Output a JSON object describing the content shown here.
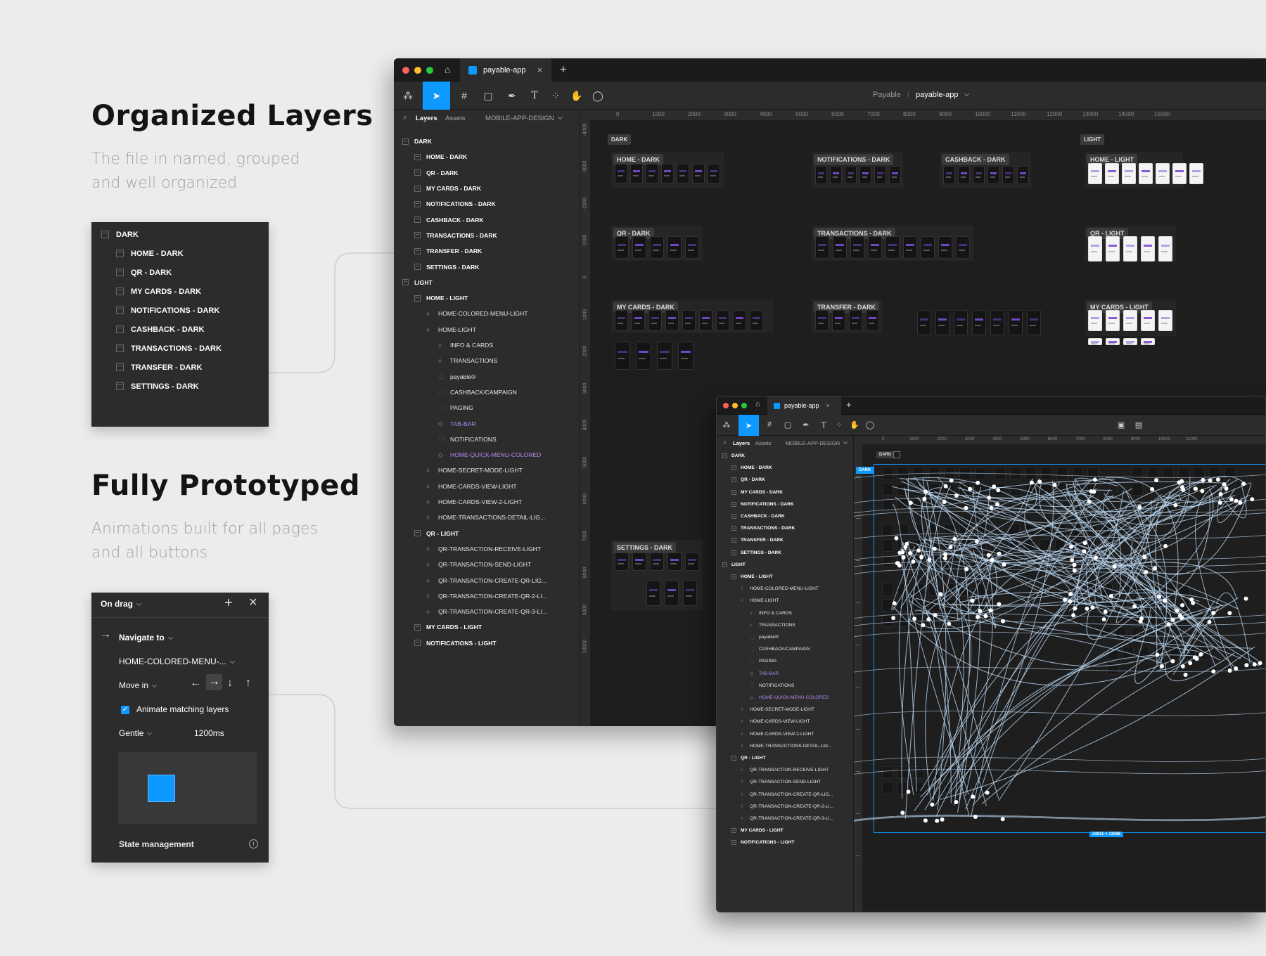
{
  "headings": {
    "organized_title": "Organized Layers",
    "organized_desc_1": "The file in named, grouped",
    "organized_desc_2": "and well organized",
    "prototyped_title": "Fully Prototyped",
    "prototyped_desc_1": "Animations built for all pages",
    "prototyped_desc_2": "and all buttons"
  },
  "layer_panel": {
    "group": "DARK",
    "items": [
      "HOME - DARK",
      "QR - DARK",
      "MY CARDS - DARK",
      "NOTIFICATIONS - DARK",
      "CASHBACK - DARK",
      "TRANSACTIONS - DARK",
      "TRANSFER - DARK",
      "SETTINGS - DARK"
    ]
  },
  "proto_panel": {
    "trigger": "On drag",
    "action": "Navigate to",
    "destination": "HOME-COLORED-MENU-...",
    "animation": "Move in",
    "animate_matching": "Animate matching layers",
    "easing": "Gentle",
    "duration": "1200ms",
    "state": "State management",
    "direction_selected": "right"
  },
  "main_window": {
    "tab": "payable-app",
    "breadcrumb_team": "Payable",
    "breadcrumb_sep": "/",
    "breadcrumb_file": "payable-app",
    "sidebar_tabs": [
      "Layers",
      "Assets"
    ],
    "page_select": "MOBILE-APP-DESIGN",
    "ruler_x": [
      "0",
      "1000",
      "2000",
      "3000",
      "4000",
      "5000",
      "6000",
      "7000",
      "8000",
      "9000",
      "10000",
      "11000",
      "12000",
      "13000",
      "14000",
      "15000"
    ],
    "ruler_y": [
      "-4000",
      "-3000",
      "-2000",
      "-1000",
      "0",
      "1000",
      "2000",
      "3000",
      "4000",
      "5000",
      "6000",
      "7000",
      "8000",
      "9000",
      "10000"
    ],
    "layers": [
      {
        "t": "DARK",
        "lvl": 0,
        "k": "frame",
        "b": true
      },
      {
        "t": "HOME - DARK",
        "lvl": 1,
        "k": "frame",
        "b": true
      },
      {
        "t": "QR - DARK",
        "lvl": 1,
        "k": "frame",
        "b": true
      },
      {
        "t": "MY CARDS - DARK",
        "lvl": 1,
        "k": "frame",
        "b": true
      },
      {
        "t": "NOTIFICATIONS - DARK",
        "lvl": 1,
        "k": "frame",
        "b": true
      },
      {
        "t": "CASHBACK - DARK",
        "lvl": 1,
        "k": "frame",
        "b": true
      },
      {
        "t": "TRANSACTIONS - DARK",
        "lvl": 1,
        "k": "frame",
        "b": true
      },
      {
        "t": "TRANSFER - DARK",
        "lvl": 1,
        "k": "frame",
        "b": true
      },
      {
        "t": "SETTINGS - DARK",
        "lvl": 1,
        "k": "frame",
        "b": true
      },
      {
        "t": "LIGHT",
        "lvl": 0,
        "k": "frame",
        "b": true
      },
      {
        "t": "HOME - LIGHT",
        "lvl": 1,
        "k": "frame",
        "b": true
      },
      {
        "t": "HOME-COLORED-MENU-LIGHT",
        "lvl": 2,
        "k": "grid"
      },
      {
        "t": "HOME-LIGHT",
        "lvl": 2,
        "k": "grid"
      },
      {
        "t": "INFO & CARDS",
        "lvl": 3,
        "k": "grid"
      },
      {
        "t": "TRANSACTIONS",
        "lvl": 3,
        "k": "grid"
      },
      {
        "t": "payable®",
        "lvl": 3,
        "k": "dash"
      },
      {
        "t": "CASHBACK/CAMPAIGN",
        "lvl": 3,
        "k": "dash"
      },
      {
        "t": "PAGING",
        "lvl": 3,
        "k": "dash"
      },
      {
        "t": "TAB-BAR",
        "lvl": 3,
        "k": "comp",
        "p": true
      },
      {
        "t": "NOTIFICATIONS",
        "lvl": 3,
        "k": "dash"
      },
      {
        "t": "HOME-QUICK-MENU-COLORED",
        "lvl": 3,
        "k": "comp",
        "p": true
      },
      {
        "t": "HOME-SECRET-MODE-LIGHT",
        "lvl": 2,
        "k": "grid"
      },
      {
        "t": "HOME-CARDS-VIEW-LIGHT",
        "lvl": 2,
        "k": "grid"
      },
      {
        "t": "HOME-CARDS-VIEW-2-LIGHT",
        "lvl": 2,
        "k": "grid"
      },
      {
        "t": "HOME-TRANSACTIONS-DETAIL-LIG...",
        "lvl": 2,
        "k": "grid"
      },
      {
        "t": "QR - LIGHT",
        "lvl": 1,
        "k": "frame",
        "b": true
      },
      {
        "t": "QR-TRANSACTION-RECEIVE-LIGHT",
        "lvl": 2,
        "k": "grid"
      },
      {
        "t": "QR-TRANSACTION-SEND-LIGHT",
        "lvl": 2,
        "k": "grid"
      },
      {
        "t": "QR-TRANSACTION-CREATE-QR-LIG...",
        "lvl": 2,
        "k": "grid"
      },
      {
        "t": "QR-TRANSACTION-CREATE-QR-2-LI...",
        "lvl": 2,
        "k": "grid"
      },
      {
        "t": "QR-TRANSACTION-CREATE-QR-3-LI...",
        "lvl": 2,
        "k": "grid"
      },
      {
        "t": "MY CARDS - LIGHT",
        "lvl": 1,
        "k": "frame",
        "b": true
      },
      {
        "t": "NOTIFICATIONS - LIGHT",
        "lvl": 1,
        "k": "frame",
        "b": true
      }
    ],
    "canvas_labels": [
      "DARK",
      "LIGHT",
      "HOME - DARK",
      "NOTIFICATIONS - DARK",
      "CASHBACK - DARK",
      "HOME - LIGHT",
      "QR - DARK",
      "TRANSACTIONS - DARK",
      "QR - LIGHT",
      "MY CARDS - DARK",
      "TRANSFER - DARK",
      "MY CARDS - LIGHT",
      "SETTINGS - DARK"
    ]
  },
  "second_window": {
    "tab": "payable-app",
    "sidebar_tabs": [
      "Layers",
      "Assets"
    ],
    "page_select": "MOBILE-APP-DESIGN",
    "ruler_x": [
      "0",
      "1000",
      "2000",
      "3000",
      "4000",
      "5000",
      "6000",
      "7000",
      "8000",
      "9000",
      "10000",
      "11000"
    ],
    "canvas_label": "DARK",
    "selection_tag": "DARK",
    "size_badge": "34011 × 13068"
  },
  "colors": {
    "accent_blue": "#0d99ff",
    "purple": "#b18af0",
    "prototype_lines": "#bcd8f2",
    "panel": "#2c2c2c",
    "canvas": "#1e1e1e"
  }
}
